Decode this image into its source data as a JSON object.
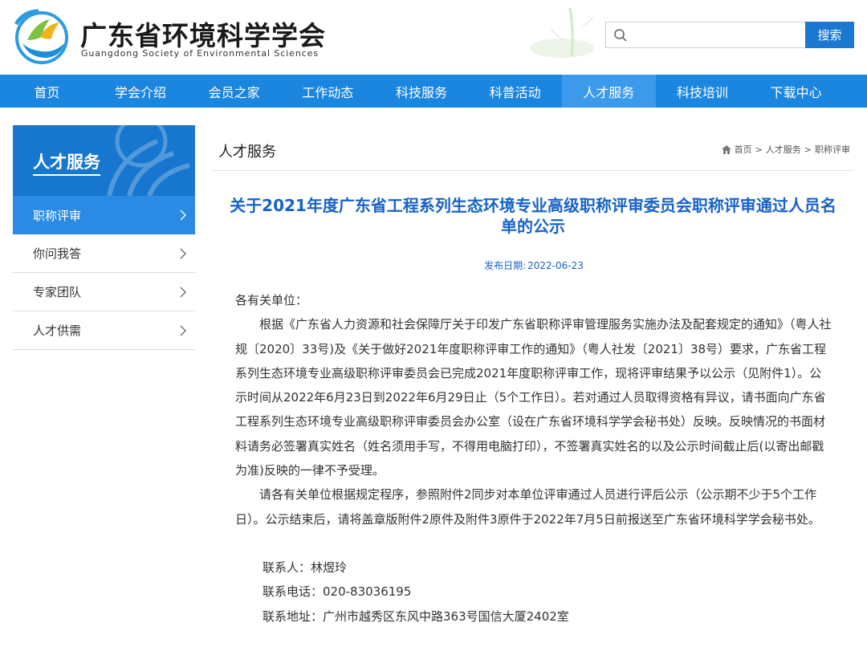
{
  "site": {
    "name_cn": "广东省环境科学学会",
    "name_en": "Guangdong Society of Environmental Sciences"
  },
  "search": {
    "placeholder": "",
    "button": "搜索"
  },
  "nav": {
    "items": [
      "首页",
      "学会介绍",
      "会员之家",
      "工作动态",
      "科技服务",
      "科普活动",
      "人才服务",
      "科技培训",
      "下载中心"
    ],
    "active": "人才服务"
  },
  "sidebar": {
    "title": "人才服务",
    "items": [
      "职称评审",
      "你问我答",
      "专家团队",
      "人才供需"
    ],
    "active": "职称评审"
  },
  "main": {
    "section_title": "人才服务",
    "breadcrumb": [
      "首页",
      "人才服务",
      "职称评审"
    ],
    "breadcrumb_sep": ">",
    "article": {
      "title": "关于2021年度广东省工程系列生态环境专业高级职称评审委员会职称评审通过人员名单的公示",
      "date_label": "发布日期:",
      "date": "2022-06-23",
      "salutation": "各有关单位：",
      "para1": "根据《广东省人力资源和社会保障厅关于印发广东省职称评审管理服务实施办法及配套规定的通知》（粤人社规〔2020〕33号)及《关于做好2021年度职称评审工作的通知》（粤人社发〔2021〕38号）要求，广东省工程系列生态环境专业高级职称评审委员会已完成2021年度职称评审工作，现将评审结果予以公示（见附件1）。公示时间从2022年6月23日到2022年6月29日止（5个工作日）。若对通过人员取得资格有异议，请书面向广东省工程系列生态环境专业高级职称评审委员会办公室（设在广东省环境科学学会秘书处）反映。反映情况的书面材料请务必签署真实姓名（姓名须用手写，不得用电脑打印），不签署真实姓名的以及公示时间截止后(以寄出邮戳为准)反映的一律不予受理。",
      "para2": "请各有关单位根据规定程序，参照附件2同步对本单位评审通过人员进行评后公示（公示期不少于5个工作日）。公示结束后，请将盖章版附件2原件及附件3原件于2022年7月5日前报送至广东省环境科学学会秘书处。",
      "contact_person": "联系人：林煜玲",
      "contact_phone": "联系电话：020-83036195",
      "contact_address": "联系地址：广州市越秀区东风中路363号国信大厦2402室"
    }
  },
  "colors": {
    "nav_bg": "#1a86e0",
    "nav_active": "#3b9aea",
    "sidebar_head": "#1777cf",
    "sidebar_active": "#2b8ae3",
    "title_blue": "#1763c7",
    "search_button": "#1a77d2"
  }
}
